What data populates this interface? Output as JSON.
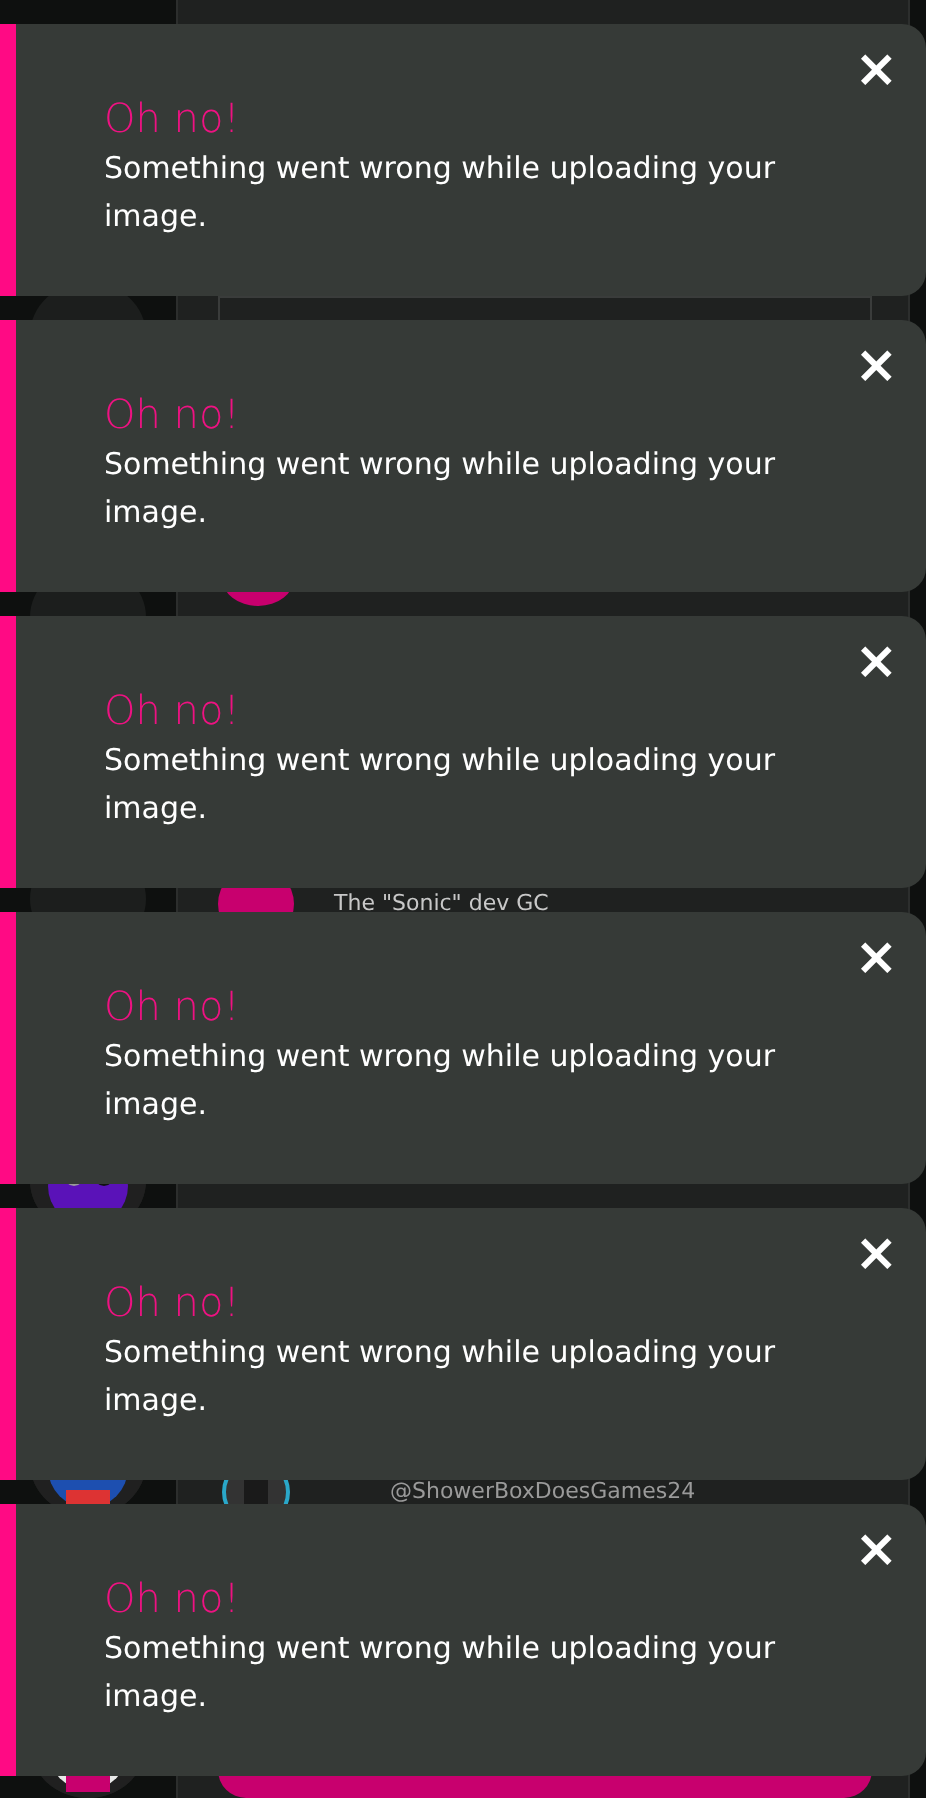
{
  "background": {
    "chats": [
      {
        "name": "The \"Sonic\" dev GC",
        "kind": "group"
      },
      {
        "name": "@ShowerBoxDoesGames24",
        "kind": "user"
      }
    ]
  },
  "toasts": [
    {
      "title": "Oh no!",
      "message": "Something went wrong while uploading your image.",
      "close": "×"
    },
    {
      "title": "Oh no!",
      "message": "Something went wrong while uploading your image.",
      "close": "×"
    },
    {
      "title": "Oh no!",
      "message": "Something went wrong while uploading your image.",
      "close": "×"
    },
    {
      "title": "Oh no!",
      "message": "Something went wrong while uploading your image.",
      "close": "×"
    },
    {
      "title": "Oh no!",
      "message": "Something went wrong while uploading your image.",
      "close": "×"
    },
    {
      "title": "Oh no!",
      "message": "Something went wrong while uploading your image.",
      "close": "×"
    }
  ]
}
